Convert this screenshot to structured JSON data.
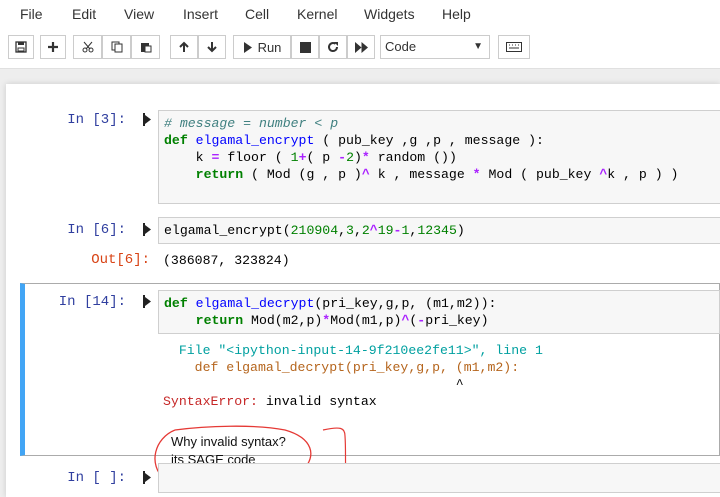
{
  "menu": [
    "File",
    "Edit",
    "View",
    "Insert",
    "Cell",
    "Kernel",
    "Widgets",
    "Help"
  ],
  "toolbar": {
    "run_label": "Run",
    "cell_type": "Code"
  },
  "cells": [
    {
      "prompt": "In [3]:",
      "lines": [
        "# message = number < p",
        "def elgamal_encrypt ( pub_key ,g ,p , message ):",
        "    k = floor ( 1+( p -2)* random ())",
        "    return ( Mod (g , p )^ k , message * Mod ( pub_key ^k , p ) )"
      ]
    },
    {
      "prompt": "In [6]:",
      "lines": [
        "elgamal_encrypt(210904,3,2^19-1,12345)"
      ],
      "out_prompt": "Out[6]:",
      "output": "(386087, 323824)"
    },
    {
      "prompt": "In [14]:",
      "lines": [
        "def elgamal_decrypt(pri_key,g,p, (m1,m2)):",
        "    return Mod(m2,p)*Mod(m1,p)^(-pri_key)"
      ],
      "traceback": {
        "file_line": "  File \"<ipython-input-14-9f210ee2fe11>\", line 1",
        "code_line": "    def elgamal_decrypt(pri_key,g,p, (m1,m2):",
        "caret_line": "                                     ^",
        "error_name": "SyntaxError:",
        "error_msg": " invalid syntax"
      }
    },
    {
      "prompt": "In [ ]:",
      "lines": [
        ""
      ]
    }
  ],
  "annotation": {
    "line1": "Why invalid syntax?",
    "line2": "its SAGE code"
  }
}
